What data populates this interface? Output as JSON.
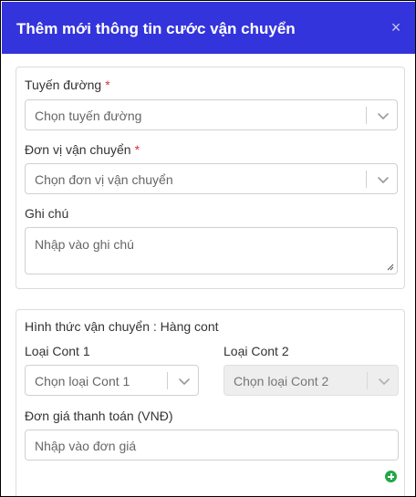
{
  "modal": {
    "title": "Thêm mới thông tin cước vận chuyển",
    "close_glyph": "×",
    "accent_color": "#3434dc"
  },
  "route": {
    "label": "Tuyến đường",
    "required_mark": "*",
    "placeholder": "Chọn tuyến đường"
  },
  "carrier": {
    "label": "Đơn vị vận chuyển",
    "required_mark": "*",
    "placeholder": "Chọn đơn vị vận chuyển"
  },
  "note": {
    "label": "Ghi chú",
    "placeholder": "Nhập vào ghi chú"
  },
  "shipping": {
    "method_label": "Hình thức vận chuyển : Hàng cont",
    "cont1": {
      "label": "Loại Cont 1",
      "placeholder": "Chọn loại Cont 1"
    },
    "cont2": {
      "label": "Loại Cont 2",
      "placeholder": "Chọn loại Cont 2",
      "disabled": true
    },
    "price": {
      "label": "Đơn giá thanh toán (VNĐ)",
      "placeholder": "Nhập vào đơn giá"
    },
    "add_icon": "plus-circle-icon",
    "add_color": "#22a745"
  },
  "icons": {
    "close": "close-icon",
    "dropdown": "chevron-down-icon"
  }
}
